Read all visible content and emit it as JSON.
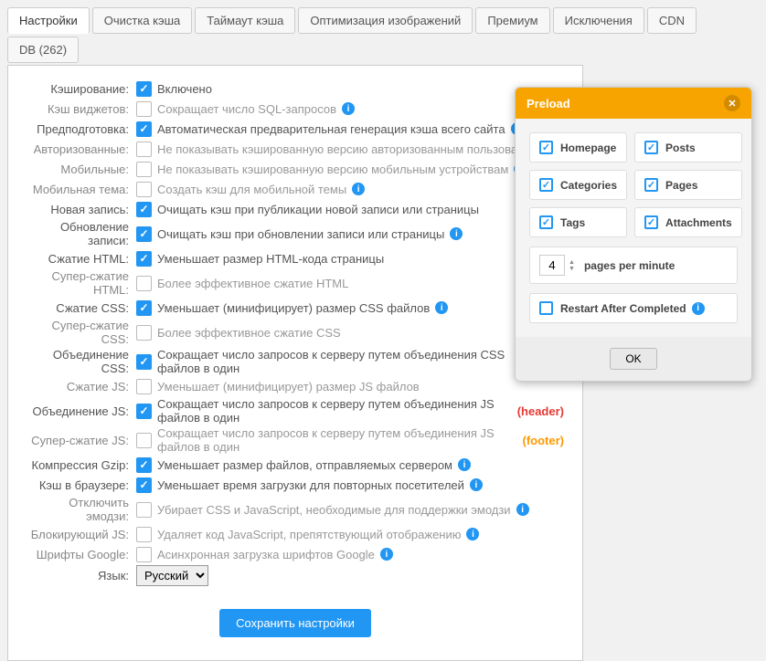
{
  "tabs": [
    "Настройки",
    "Очистка кэша",
    "Таймаут кэша",
    "Оптимизация изображений",
    "Премиум",
    "Исключения",
    "CDN",
    "DB (262)"
  ],
  "settings": [
    {
      "label": "Кэширование:",
      "checked": true,
      "desc": "Включено",
      "info": false,
      "dim": false
    },
    {
      "label": "Кэш виджетов:",
      "checked": false,
      "desc": "Сокращает число SQL-запросов",
      "info": true,
      "dim": true
    },
    {
      "label": "Предподготовка:",
      "checked": true,
      "desc": "Автоматическая предварительная генерация кэша всего сайта",
      "info": true,
      "dim": false
    },
    {
      "label": "Авторизованные:",
      "checked": false,
      "desc": "Не показывать кэшированную версию авторизованным пользователям",
      "info": false,
      "dim": true
    },
    {
      "label": "Мобильные:",
      "checked": false,
      "desc": "Не показывать кэшированную версию мобильным устройствам",
      "info": true,
      "dim": true
    },
    {
      "label": "Мобильная тема:",
      "checked": false,
      "desc": "Создать кэш для мобильной темы",
      "info": true,
      "dim": true
    },
    {
      "label": "Новая запись:",
      "checked": true,
      "desc": "Очищать кэш при публикации новой записи или страницы",
      "info": false,
      "dim": false
    },
    {
      "label": "Обновление записи:",
      "checked": true,
      "desc": "Очищать кэш при обновлении записи или страницы",
      "info": true,
      "dim": false
    },
    {
      "label": "Сжатие HTML:",
      "checked": true,
      "desc": "Уменьшает размер HTML-кода страницы",
      "info": false,
      "dim": false
    },
    {
      "label": "Супер-сжатие HTML:",
      "checked": false,
      "desc": "Более эффективное сжатие HTML",
      "info": false,
      "dim": true
    },
    {
      "label": "Сжатие CSS:",
      "checked": true,
      "desc": "Уменьшает (минифицирует) размер CSS файлов",
      "info": true,
      "dim": false
    },
    {
      "label": "Супер-сжатие CSS:",
      "checked": false,
      "desc": "Более эффективное сжатие CSS",
      "info": false,
      "dim": true
    },
    {
      "label": "Объединение CSS:",
      "checked": true,
      "desc": "Сокращает число запросов к серверу путем объединения CSS файлов в один",
      "info": true,
      "dim": false
    },
    {
      "label": "Сжатие JS:",
      "checked": false,
      "desc": "Уменьшает (минифицирует) размер JS файлов",
      "info": false,
      "dim": true
    },
    {
      "label": "Объединение JS:",
      "checked": true,
      "desc": "Сокращает число запросов к серверу путем объединения JS файлов в один",
      "suffix": "(header)",
      "suffixClass": "hl-h",
      "info": false,
      "dim": false
    },
    {
      "label": "Супер-сжатие JS:",
      "checked": false,
      "desc": "Сокращает число запросов к серверу путем объединения JS файлов в один",
      "suffix": "(footer)",
      "suffixClass": "hl-f",
      "info": false,
      "dim": true
    },
    {
      "label": "Компрессия Gzip:",
      "checked": true,
      "desc": "Уменьшает размер файлов, отправляемых сервером",
      "info": true,
      "dim": false
    },
    {
      "label": "Кэш в браузере:",
      "checked": true,
      "desc": "Уменьшает время загрузки для повторных посетителей",
      "info": true,
      "dim": false
    },
    {
      "label": "Отключить эмодзи:",
      "checked": false,
      "desc": "Убирает CSS и JavaScript, необходимые для поддержки эмодзи",
      "info": true,
      "dim": true
    },
    {
      "label": "Блокирующий JS:",
      "checked": false,
      "desc": "Удаляет код JavaScript, препятствующий отображению",
      "info": true,
      "dim": true
    },
    {
      "label": "Шрифты Google:",
      "checked": false,
      "desc": "Асинхронная загрузка шрифтов Google",
      "info": true,
      "dim": true
    }
  ],
  "lang": {
    "label": "Язык:",
    "value": "Русский"
  },
  "save": "Сохранить настройки",
  "modal": {
    "title": "Preload",
    "options": [
      {
        "label": "Homepage",
        "checked": true
      },
      {
        "label": "Posts",
        "checked": true
      },
      {
        "label": "Categories",
        "checked": true
      },
      {
        "label": "Pages",
        "checked": true
      },
      {
        "label": "Tags",
        "checked": true
      },
      {
        "label": "Attachments",
        "checked": true
      }
    ],
    "ppm": {
      "value": "4",
      "label": "pages per minute"
    },
    "restart": {
      "checked": false,
      "label": "Restart After Completed"
    },
    "ok": "OK"
  }
}
